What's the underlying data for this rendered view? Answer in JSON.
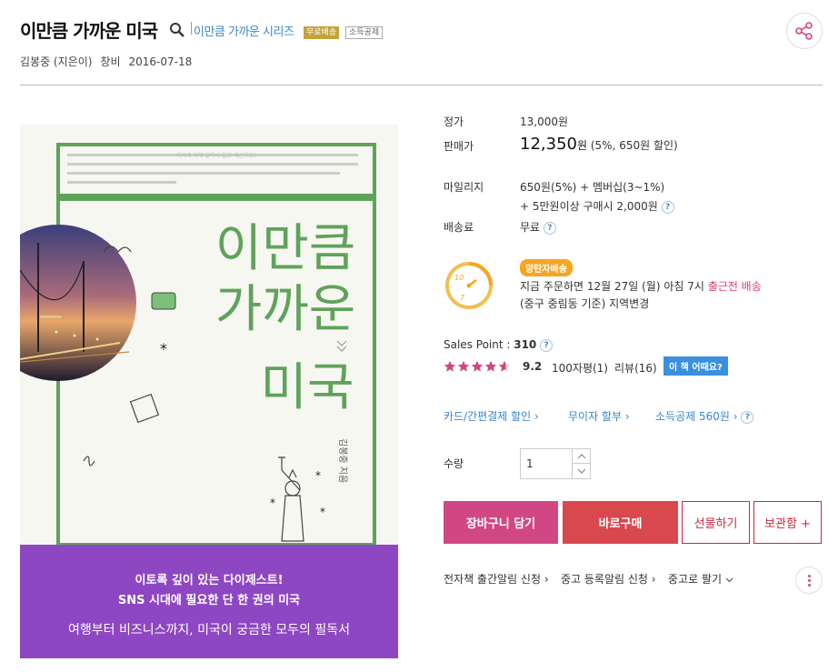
{
  "header": {
    "title": "이만큼 가까운 미국",
    "series": "이만큼 가까운 시리즈",
    "badge_free": "무료배송",
    "badge_tax": "소득공제",
    "author": "김봉중 (지은이)",
    "publisher": "창비",
    "date": "2016-07-18"
  },
  "cover": {
    "top_blurb": "미국에 대해 얼마나 알고 계신가요?",
    "title_line1": "이만큼",
    "title_line2": "가까운",
    "title_line3": "미국",
    "author_vertical": "김봉중 지음",
    "band_line1": "이토록 깊이 있는 다이제스트!",
    "band_line2": "SNS 시대에 필요한 단 한 권의 미국",
    "band_line3": "여행부터 비즈니스까지, 미국이 궁금한 모두의 필독서",
    "colors": {
      "green": "#5fa35a",
      "purple": "#8e47c2",
      "band_text": "#ffffff"
    }
  },
  "price": {
    "list_label": "정가",
    "list_value": "13,000원",
    "sale_label": "판매가",
    "sale_number": "12,350",
    "sale_unit": "원",
    "sale_note": "(5%, 650원 할인)"
  },
  "mileage": {
    "label": "마일리지",
    "line1": "650원(5%) + 멤버십(3~1%)",
    "line2": "+ 5만원이상 구매시 2,000원"
  },
  "shipping": {
    "label": "배송료",
    "value": "무료"
  },
  "delivery": {
    "badge": "양탄자배송",
    "line1_pre": "지금 주문하면 12월 27일 (월) 아침 7시 ",
    "line1_highlight": "출근전 배송",
    "line2": "(중구 중림동 기준) 지역변경",
    "clock_top": "10",
    "clock_bottom": "7"
  },
  "sales": {
    "label": "Sales Point : ",
    "value": "310",
    "rating_value": 4.6,
    "rating": "9.2",
    "reviews_short": "100자평(1)",
    "reviews": "리뷰(16)",
    "how_button": "이 책 어때요?"
  },
  "benefits": {
    "card": "카드/간편결제 할인",
    "installment": "무이자 할부",
    "deduction": "소득공제 560원"
  },
  "quantity": {
    "label": "수량",
    "value": "1"
  },
  "buttons": {
    "cart": "장바구니 담기",
    "buy": "바로구매",
    "gift": "선물하기",
    "save": "보관함 +"
  },
  "bottom_links": {
    "ebook": "전자책 출간알림 신청",
    "used_alert": "중고 등록알림 신청",
    "used_sell": "중고로 팔기"
  },
  "colors": {
    "link_blue": "#3a86c8",
    "pink": "#d14784",
    "red": "#d9474f",
    "orange": "#f5a623"
  }
}
